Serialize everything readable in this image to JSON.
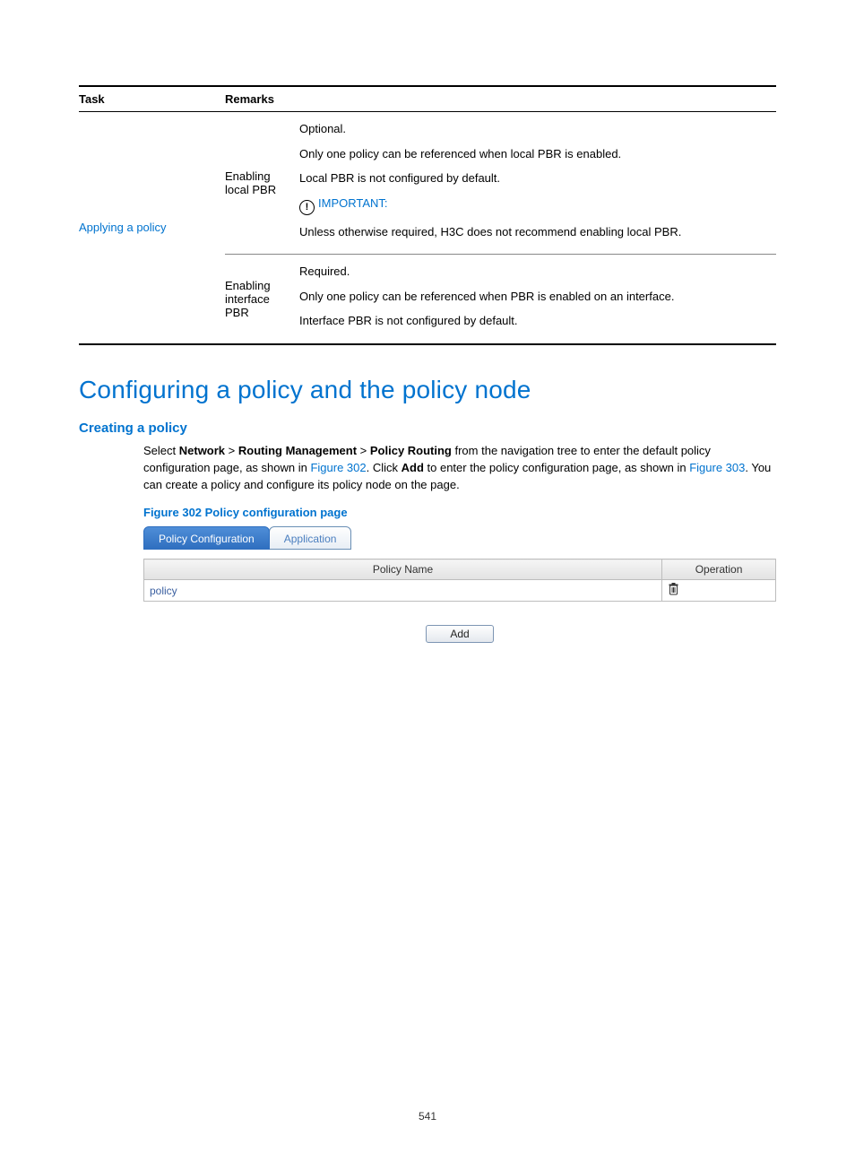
{
  "table": {
    "headers": {
      "task": "Task",
      "remarks": "Remarks"
    },
    "taskLink": "Applying a policy",
    "row1": {
      "remarkTitle": "Enabling local PBR",
      "p1": "Optional.",
      "p2": "Only one policy can be referenced when local PBR is enabled.",
      "p3": "Local PBR is not configured by default.",
      "importantLabel": "IMPORTANT:",
      "p4": "Unless otherwise required, H3C does not recommend enabling local PBR."
    },
    "row2": {
      "remarkTitle": "Enabling interface PBR",
      "p1": "Required.",
      "p2": "Only one policy can be referenced when PBR is enabled on an interface.",
      "p3": "Interface PBR is not configured by default."
    }
  },
  "section": {
    "title": "Configuring a policy and the policy node",
    "subsection": "Creating a policy",
    "para": {
      "t1": "Select ",
      "b1": "Network",
      "gt1": " > ",
      "b2": "Routing Management",
      "gt2": " > ",
      "b3": "Policy Routing",
      "t2": " from the navigation tree to enter the default policy configuration page, as shown in ",
      "link1": "Figure 302",
      "t3": ". Click ",
      "b4": "Add",
      "t4": " to enter the policy configuration page, as shown in ",
      "link2": "Figure 303",
      "t5": ". You can create a policy and configure its policy node on the page."
    },
    "figureCaption": "Figure 302 Policy configuration page"
  },
  "figure": {
    "tabs": {
      "active": "Policy Configuration",
      "inactive": "Application"
    },
    "headers": {
      "name": "Policy Name",
      "op": "Operation"
    },
    "row": {
      "name": "policy"
    },
    "addBtn": "Add"
  },
  "pageNumber": "541"
}
